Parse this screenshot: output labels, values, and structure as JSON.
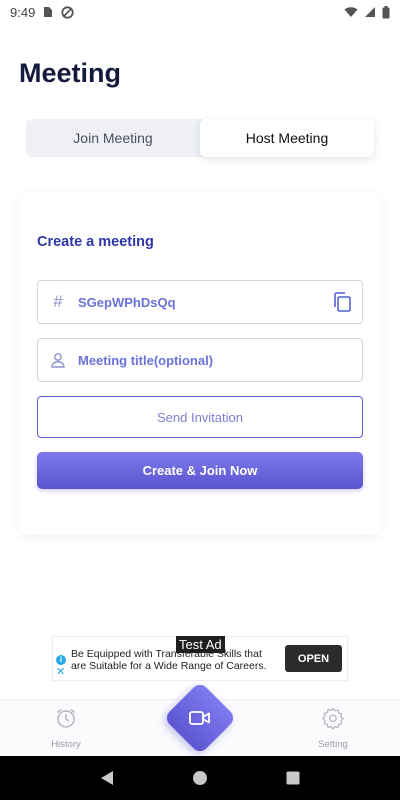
{
  "status_bar": {
    "time": "9:49"
  },
  "page": {
    "title": "Meeting"
  },
  "tabs": [
    {
      "label": "Join Meeting",
      "active": false
    },
    {
      "label": "Host Meeting",
      "active": true
    }
  ],
  "create": {
    "heading": "Create a meeting",
    "meeting_id_prefix": "#",
    "meeting_id": "SGepWPhDsQq",
    "title_placeholder": "Meeting title(optional)",
    "send_invitation_label": "Send Invitation",
    "create_join_label": "Create & Join Now"
  },
  "ad": {
    "label": "Test Ad",
    "text": "Be Equipped with Transferable Skills that are Suitable for a Wide Range of Careers.",
    "cta": "OPEN"
  },
  "bottom_nav": {
    "history_label": "History",
    "setting_label": "Setting"
  },
  "colors": {
    "accent": "#5a55cf",
    "heading_blue": "#2e36a6",
    "field_text": "#6a72d8",
    "title_dark": "#151a3d"
  },
  "icons": {
    "status": [
      "sim-card-icon",
      "do-not-disturb-icon",
      "wifi-icon",
      "signal-icon",
      "battery-icon"
    ],
    "field_title": "user-icon",
    "copy": "copy-icon",
    "history": "alarm-clock-icon",
    "setting": "gear-icon",
    "fab": "video-camera-icon"
  }
}
